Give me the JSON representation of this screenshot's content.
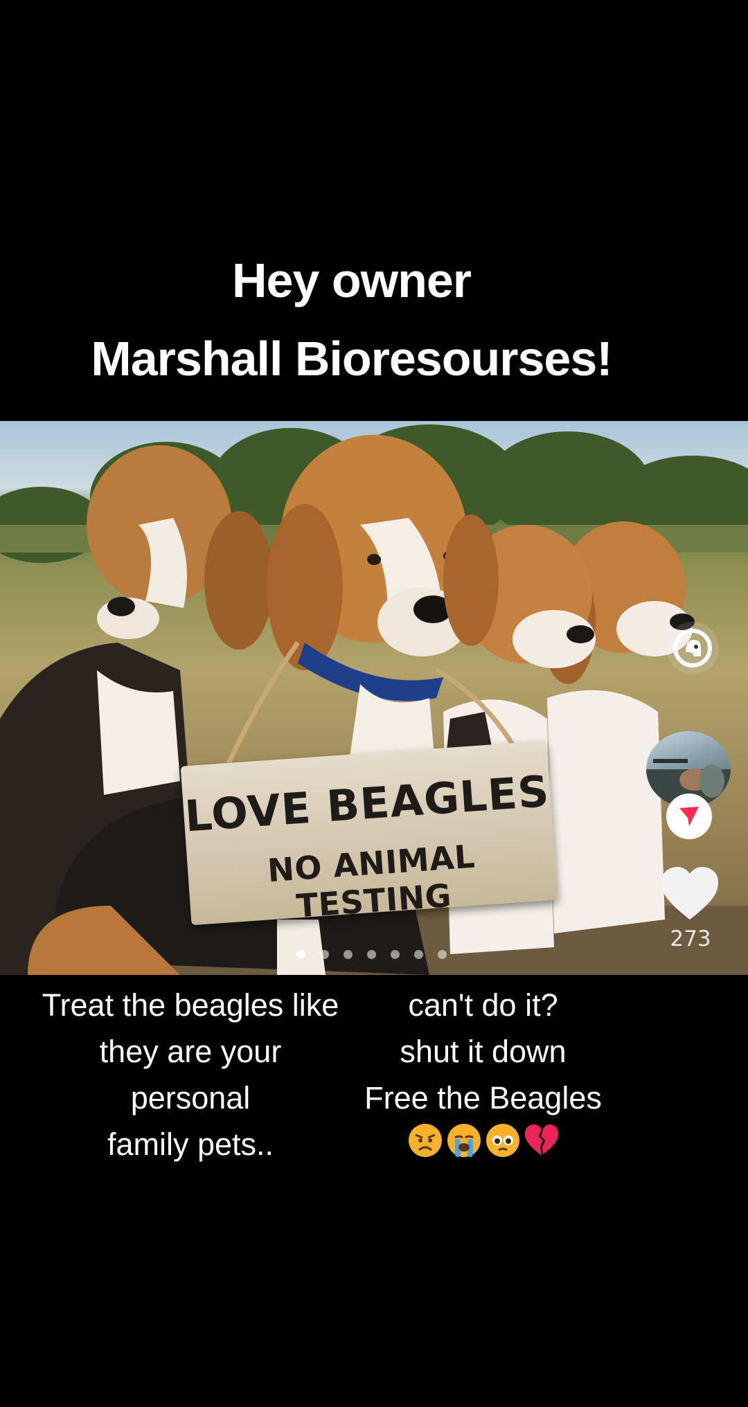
{
  "headline": {
    "line1": "Hey owner",
    "line2": "Marshall Bioresourses!"
  },
  "photo": {
    "sign_line1": "LOVE BEAGLES",
    "sign_line2": "NO ANIMAL TESTING",
    "carousel_count": 7,
    "carousel_active_index": 0
  },
  "side_actions": {
    "like_count": "273"
  },
  "caption_left": [
    "Treat the beagles like",
    "they are your",
    "personal",
    "family pets.."
  ],
  "caption_right": [
    "can't do it?",
    "shut it down",
    "Free the Beagles"
  ],
  "caption_emojis": [
    "angry-face",
    "crying-face",
    "pleading-face",
    "broken-heart"
  ],
  "colors": {
    "background": "#000000",
    "text": "#ffffff",
    "share_accent": "#ff2a4d"
  }
}
